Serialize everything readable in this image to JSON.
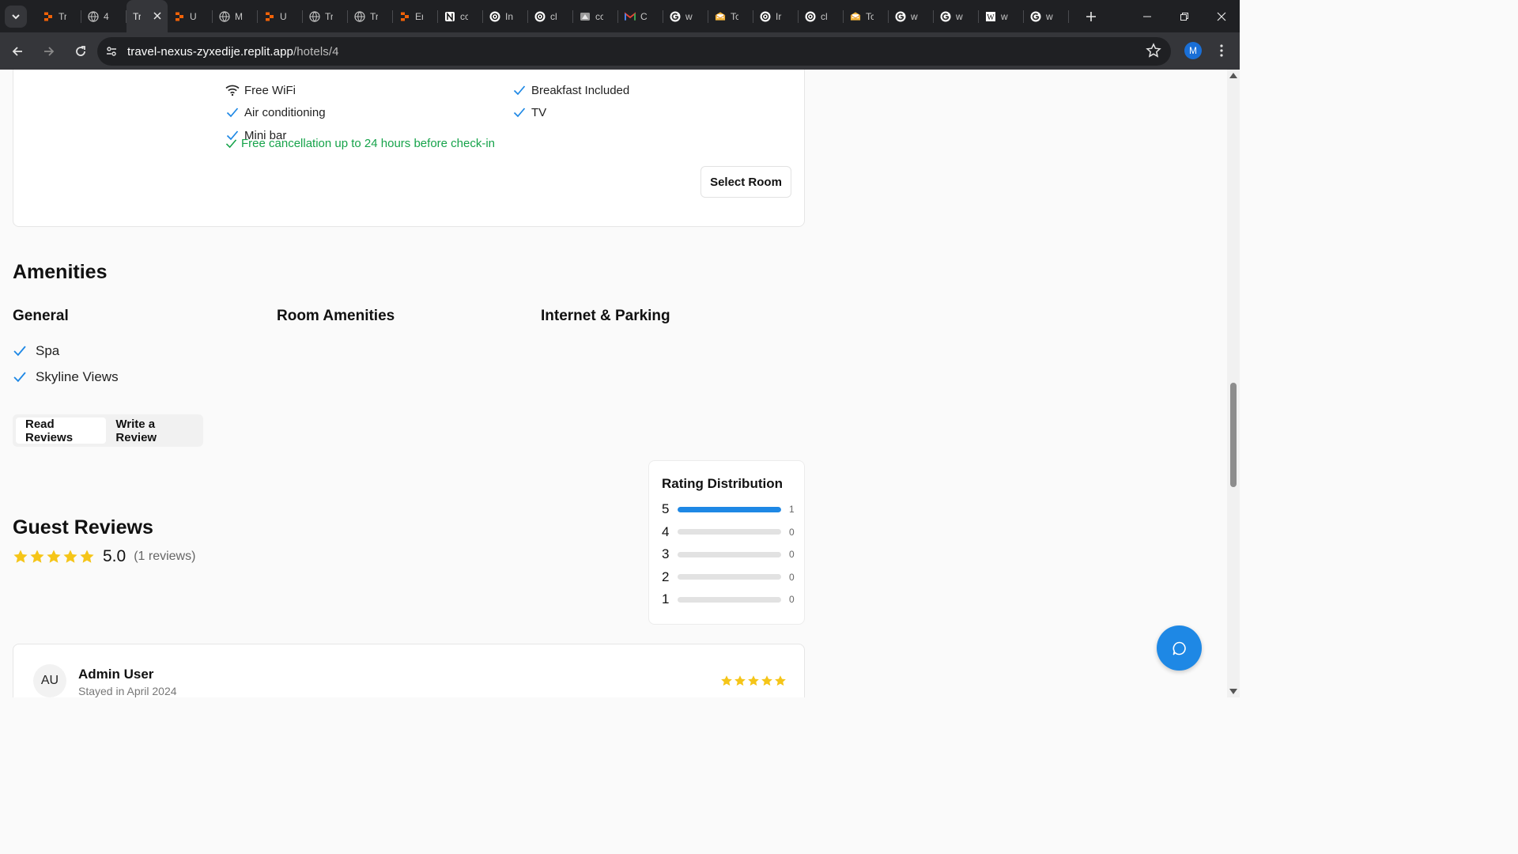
{
  "browser": {
    "tabs": [
      {
        "title": "Tr",
        "icon": "replit-icon"
      },
      {
        "title": "4",
        "icon": "globe-icon"
      },
      {
        "title": "Tr",
        "icon": "none",
        "active": true
      },
      {
        "title": "U",
        "icon": "replit-icon"
      },
      {
        "title": "M",
        "icon": "globe-icon"
      },
      {
        "title": "U",
        "icon": "replit-icon"
      },
      {
        "title": "Tr",
        "icon": "globe-icon"
      },
      {
        "title": "Tr",
        "icon": "globe-icon"
      },
      {
        "title": "Er",
        "icon": "replit-icon"
      },
      {
        "title": "cc",
        "icon": "notion-icon"
      },
      {
        "title": "In",
        "icon": "openai-icon"
      },
      {
        "title": "cl",
        "icon": "openai-icon"
      },
      {
        "title": "cc",
        "icon": "drive-icon"
      },
      {
        "title": "C",
        "icon": "gmail-icon"
      },
      {
        "title": "w",
        "icon": "google-icon"
      },
      {
        "title": "Tc",
        "icon": "mail-icon"
      },
      {
        "title": "Ir",
        "icon": "openai-icon"
      },
      {
        "title": "cl",
        "icon": "openai-icon"
      },
      {
        "title": "Tc",
        "icon": "mail-icon"
      },
      {
        "title": "w",
        "icon": "google-icon"
      },
      {
        "title": "w",
        "icon": "google-icon"
      },
      {
        "title": "w",
        "icon": "wiki-icon"
      },
      {
        "title": "w",
        "icon": "google-icon"
      }
    ],
    "url_domain": "travel-nexus-zyxedije.replit.app",
    "url_path": "/hotels/4",
    "profile_initial": "M"
  },
  "room": {
    "features_left": [
      "Free WiFi",
      "Air conditioning",
      "Mini bar"
    ],
    "features_right": [
      "Breakfast Included",
      "TV"
    ],
    "cancellation": "Free cancellation up to 24 hours before check-in",
    "select_label": "Select Room"
  },
  "amenities": {
    "title": "Amenities",
    "columns": [
      {
        "heading": "General",
        "items": [
          "Spa",
          "Skyline Views"
        ]
      },
      {
        "heading": "Room Amenities",
        "items": []
      },
      {
        "heading": "Internet & Parking",
        "items": []
      }
    ]
  },
  "review_tabs": {
    "read": "Read Reviews",
    "write": "Write a Review"
  },
  "guest_reviews": {
    "title": "Guest Reviews",
    "average": "5.0",
    "count_label": "(1 reviews)",
    "stars": 5
  },
  "rating_distribution": {
    "title": "Rating Distribution",
    "rows": [
      {
        "label": "5",
        "count": "1",
        "fraction": 1.0
      },
      {
        "label": "4",
        "count": "0",
        "fraction": 0
      },
      {
        "label": "3",
        "count": "0",
        "fraction": 0
      },
      {
        "label": "2",
        "count": "0",
        "fraction": 0
      },
      {
        "label": "1",
        "count": "0",
        "fraction": 0
      }
    ]
  },
  "review": {
    "initials": "AU",
    "name": "Admin User",
    "stay": "Stayed in April 2024",
    "stars": 5
  },
  "colors": {
    "accent": "#1e88e5",
    "star": "#f5c518",
    "success": "#16a34a"
  }
}
